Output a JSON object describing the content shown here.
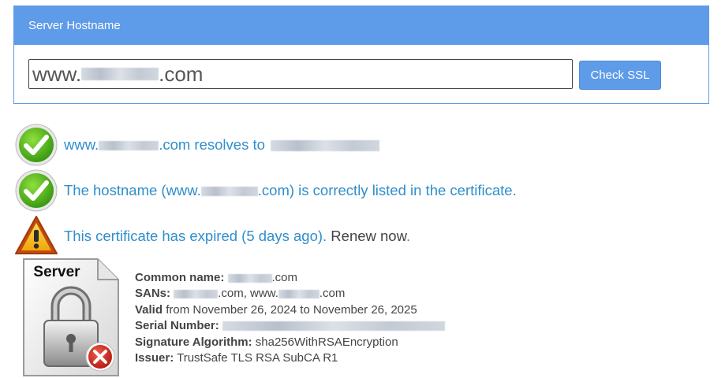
{
  "panel": {
    "title": "Server Hostname"
  },
  "search": {
    "value_prefix": "www.",
    "value_suffix": ".com"
  },
  "check_button": {
    "label": "Check SSL"
  },
  "results": [
    {
      "icon": "check-icon",
      "prefix": "www.",
      "middle": ".com resolves to"
    },
    {
      "icon": "check-icon",
      "prefix": "The hostname (www.",
      "middle": ".com) is correctly listed in the certificate."
    },
    {
      "icon": "warning-icon",
      "text": "This certificate has expired (5 days ago).",
      "renew": "Renew now",
      "after": "."
    }
  ],
  "cert_icon": {
    "label": "Server"
  },
  "certificate": {
    "common_name": {
      "label": "Common name:",
      "suffix": ".com"
    },
    "sans": {
      "label": "SANs:",
      "suffix_1": ".com, www.",
      "suffix_2": ".com"
    },
    "valid": {
      "label": "Valid",
      "value": "from November 26, 2024 to November 26, 2025"
    },
    "serial": {
      "label": "Serial Number:"
    },
    "signature": {
      "label": "Signature Algorithm:",
      "value": "sha256WithRSAEncryption"
    },
    "issuer": {
      "label": "Issuer:",
      "value": "TrustSafe TLS RSA SubCA R1"
    }
  },
  "colors": {
    "accent": "#5e9be8",
    "link": "#2f8ecb",
    "text": "#444444"
  }
}
